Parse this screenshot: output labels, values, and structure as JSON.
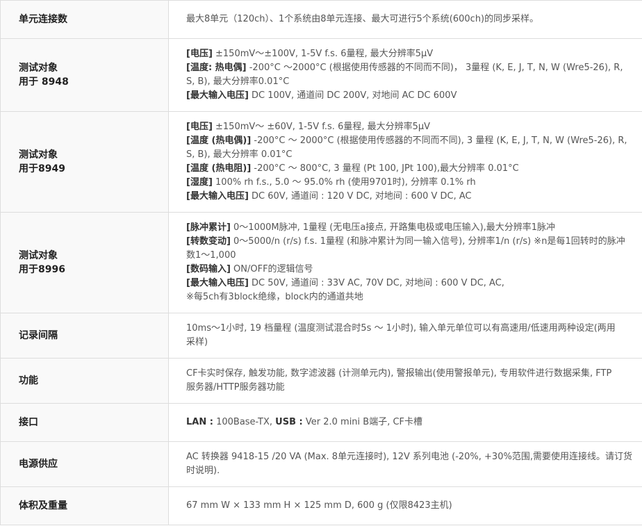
{
  "rows": [
    {
      "label": [
        "单元连接数"
      ],
      "lines": [
        [
          {
            "t": "最大8单元（120ch）、1个系统由8单元连接、最大可进行5个系统(600ch)的同步采样。"
          }
        ]
      ]
    },
    {
      "label": [
        "测试对象",
        "用于 8948"
      ],
      "lines": [
        [
          {
            "t": "[电压]",
            "b": true
          },
          {
            "t": " ±150mV～±100V, 1-5V f.s. 6量程, 最大分辨率5μV"
          }
        ],
        [
          {
            "t": "[温度: 热电偶]",
            "b": true
          },
          {
            "t": " -200°C ～2000°C (根据使用传感器的不同而不同)， 3量程 (K, E, J, T, N, W (Wre5-26), R,"
          }
        ],
        [
          {
            "t": "S, B), 最大分辨率0.01°C"
          }
        ],
        [
          {
            "t": "[最大输入电压]",
            "b": true
          },
          {
            "t": " DC 100V, 通道间 DC 200V, 对地间 AC DC 600V"
          }
        ]
      ]
    },
    {
      "label": [
        "测试对象",
        "用于8949"
      ],
      "lines": [
        [
          {
            "t": "[电压]",
            "b": true
          },
          {
            "t": " ±150mV～ ±60V, 1-5V f.s. 6量程, 最大分辨率5μV"
          }
        ],
        [
          {
            "t": "[温度 (热电偶)]",
            "b": true
          },
          {
            "t": " -200°C ～ 2000°C (根据使用传感器的不同而不同), 3 量程 (K, E, J, T, N, W (Wre5-26), R,"
          }
        ],
        [
          {
            "t": "S, B), 最大分辨率 0.01°C"
          }
        ],
        [
          {
            "t": "[温度 (热电阻)]",
            "b": true
          },
          {
            "t": " -200°C ～ 800°C, 3 量程 (Pt 100, JPt 100),最大分辨率 0.01°C"
          }
        ],
        [
          {
            "t": "[湿度]",
            "b": true
          },
          {
            "t": " 100% rh f.s., 5.0 ～ 95.0% rh (使用9701时), 分辨率 0.1% rh"
          }
        ],
        [
          {
            "t": "[最大输入电压]",
            "b": true
          },
          {
            "t": " DC 60V, 通道间 : 120 V DC, 对地间 : 600 V DC, AC"
          }
        ]
      ]
    },
    {
      "label": [
        "测试对象",
        "用于8996"
      ],
      "lines": [
        [
          {
            "t": "[脉冲累计]",
            "b": true
          },
          {
            "t": " 0～1000M脉冲, 1量程 (无电压a接点, 开路集电极或电压输入),最大分辨率1脉冲"
          }
        ],
        [
          {
            "t": "[转数变动]",
            "b": true
          },
          {
            "t": " 0～5000/n (r/s) f.s. 1量程 (和脉冲累计为同一输入信号), 分辨率1/n (r/s) ※n是每1回转时的脉冲"
          }
        ],
        [
          {
            "t": "数1～1,000"
          }
        ],
        [
          {
            "t": "[数码输入]",
            "b": true
          },
          {
            "t": " ON/OFF的逻辑信号"
          }
        ],
        [
          {
            "t": "[最大输入电压]",
            "b": true
          },
          {
            "t": " DC 50V, 通道间 : 33V AC, 70V DC, 对地间 : 600 V DC, AC,"
          }
        ],
        [
          {
            "t": "※每5ch有3block绝缘，block内的通道共地"
          }
        ]
      ]
    },
    {
      "label": [
        "记录间隔"
      ],
      "lines": [
        [
          {
            "t": "10ms～1小时, 19 档量程 (温度测试混合时5s ～ 1小时), 输入单元单位可以有高速用/低速用两种设定(两用"
          }
        ],
        [
          {
            "t": "采样)"
          }
        ]
      ]
    },
    {
      "label": [
        "功能"
      ],
      "lines": [
        [
          {
            "t": "CF卡实时保存, 触发功能, 数字滤波器 (计测单元内), 警报输出(使用警报单元), 专用软件进行数据采集, FTP"
          }
        ],
        [
          {
            "t": "服务器/HTTP服务器功能"
          }
        ]
      ]
    },
    {
      "label": [
        "接口"
      ],
      "lines": [
        [
          {
            "t": "LAN :",
            "b": true
          },
          {
            "t": " 100Base-TX, "
          },
          {
            "t": "USB :",
            "b": true
          },
          {
            "t": " Ver 2.0 mini B端子, CF卡槽"
          }
        ]
      ]
    },
    {
      "label": [
        "电源供应"
      ],
      "lines": [
        [
          {
            "t": "AC 转换器 9418-15 /20 VA (Max. 8单元连接时), 12V 系列电池 (-20%, +30%范围,需要使用连接线。请订货"
          }
        ],
        [
          {
            "t": "时说明)."
          }
        ]
      ]
    },
    {
      "label": [
        "体积及重量"
      ],
      "lines": [
        [
          {
            "t": "67 mm W × 133 mm H × 125 mm D, 600 g (仅限8423主机)"
          }
        ]
      ]
    }
  ]
}
